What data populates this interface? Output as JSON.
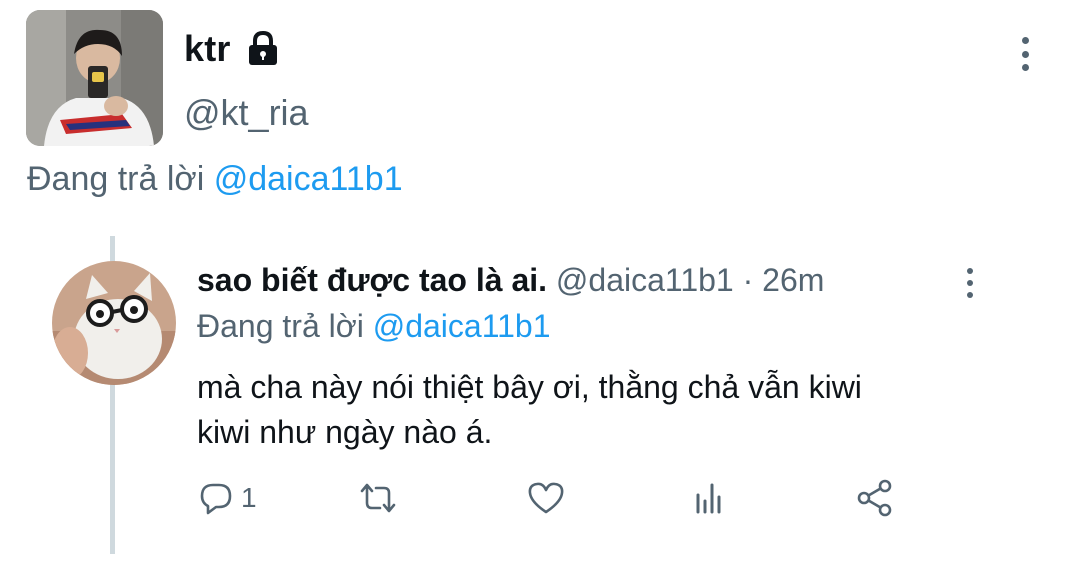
{
  "tweet": {
    "author": {
      "display_name": "ktr",
      "handle": "@kt_ria",
      "avatar_icon": "profile-photo",
      "protected_icon": "lock-icon"
    },
    "replying_prefix": "Đang trả lời",
    "replying_to": "@daica11b1"
  },
  "replied_tweet": {
    "author": {
      "display_name": "sao biết được tao là ai.",
      "handle": "@daica11b1",
      "avatar_icon": "cat-with-glasses-photo"
    },
    "time_separator": "·",
    "time": "26m",
    "replying_prefix": "Đang trả lời",
    "replying_to": "@daica11b1",
    "text_line1": "mà cha này nói thiệt bây ơi, thằng chả vẫn kiwi",
    "text_line2": "kiwi như ngày nào á.",
    "actions": {
      "reply_count": "1",
      "reply_icon": "reply-icon",
      "retweet_icon": "retweet-icon",
      "like_icon": "heart-icon",
      "stats_icon": "analytics-icon",
      "share_icon": "share-icon"
    }
  },
  "colors": {
    "text_primary": "#0f1419",
    "text_secondary": "#536471",
    "link": "#1d9bf0",
    "thread_line": "#cfd9de",
    "background": "#ffffff"
  }
}
